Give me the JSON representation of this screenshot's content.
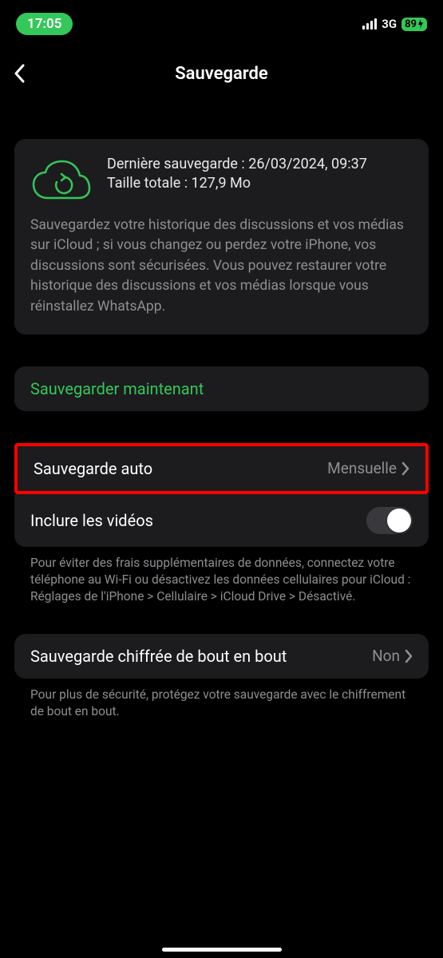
{
  "status": {
    "time": "17:05",
    "network": "3G",
    "battery": "89"
  },
  "header": {
    "title": "Sauvegarde"
  },
  "infoCard": {
    "line1": "Dernière sauvegarde : 26/03/2024, 09:37",
    "line2": "Taille totale : 127,9 Mo",
    "description": "Sauvegardez votre historique des discussions et vos médias sur iCloud ; si vous changez ou perdez votre iPhone, vos discussions sont sécurisées. Vous pouvez restaurer votre historique des discussions et vos médias lorsque vous réinstallez WhatsApp."
  },
  "actions": {
    "backupNow": "Sauvegarder maintenant"
  },
  "settings": {
    "autoBackup": {
      "label": "Sauvegarde auto",
      "value": "Mensuelle"
    },
    "includeVideos": {
      "label": "Inclure les vidéos",
      "enabled": false
    },
    "footnote": "Pour éviter des frais supplémentaires de données, connectez votre téléphone au Wi-Fi ou désactivez les données cellulaires pour iCloud :\nRéglages de l'iPhone > Cellulaire > iCloud Drive > Désactivé.",
    "e2e": {
      "label": "Sauvegarde chiffrée de bout en bout",
      "value": "Non"
    },
    "e2eFootnote": "Pour plus de sécurité, protégez votre sauvegarde avec le chiffrement de bout en bout."
  }
}
